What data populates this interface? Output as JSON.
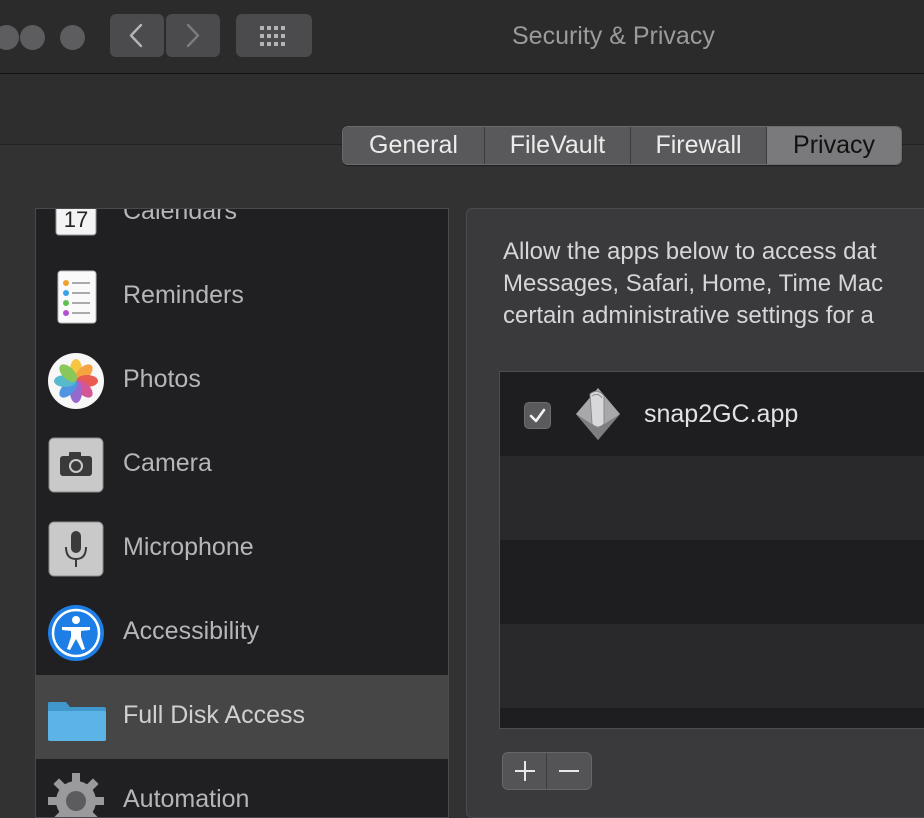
{
  "window": {
    "title": "Security & Privacy"
  },
  "tabs": [
    {
      "label": "General",
      "active": false
    },
    {
      "label": "FileVault",
      "active": false
    },
    {
      "label": "Firewall",
      "active": false
    },
    {
      "label": "Privacy",
      "active": true
    }
  ],
  "sidebar": {
    "items": [
      {
        "label": "Calendars",
        "icon": "calendar-icon"
      },
      {
        "label": "Reminders",
        "icon": "reminders-icon"
      },
      {
        "label": "Photos",
        "icon": "photos-icon"
      },
      {
        "label": "Camera",
        "icon": "camera-icon"
      },
      {
        "label": "Microphone",
        "icon": "microphone-icon"
      },
      {
        "label": "Accessibility",
        "icon": "accessibility-icon"
      },
      {
        "label": "Full Disk Access",
        "icon": "folder-icon",
        "selected": true
      },
      {
        "label": "Automation",
        "icon": "gear-icon"
      }
    ],
    "calendar_day": "17"
  },
  "main": {
    "description_lines": [
      "Allow the apps below to access dat",
      "Messages, Safari, Home, Time Mac",
      "certain administrative settings for a"
    ],
    "apps": [
      {
        "name": "snap2GC.app",
        "checked": true,
        "icon": "script-icon"
      }
    ],
    "add_label": "+",
    "remove_label": "−"
  },
  "colors": {
    "window_bg": "#323233",
    "selected_row": "#464647",
    "list_bg": "#202022",
    "folder_blue": "#5bb3e6",
    "accessibility_blue": "#1d7fe6"
  }
}
